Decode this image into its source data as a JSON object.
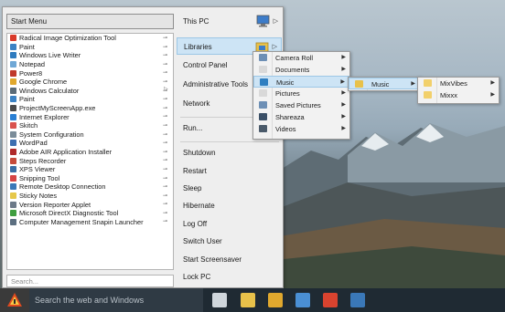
{
  "start_menu": {
    "title": "Start Menu",
    "search_placeholder": "Search...",
    "programs": [
      {
        "label": "Radical Image Optimization Tool",
        "icon": "rito-icon",
        "color": "#d93a2a"
      },
      {
        "label": "Paint",
        "icon": "paint-icon",
        "color": "#3b82c4"
      },
      {
        "label": "Windows Live Writer",
        "icon": "live-writer-icon",
        "color": "#2e7bbf"
      },
      {
        "label": "Notepad",
        "icon": "notepad-icon",
        "color": "#6fa8d6"
      },
      {
        "label": "Power8",
        "icon": "power8-icon",
        "color": "#c0392b"
      },
      {
        "label": "Google Chrome",
        "icon": "chrome-icon",
        "color": "#e0a82e"
      },
      {
        "label": "Windows Calculator",
        "icon": "calculator-icon",
        "color": "#5a6b78"
      },
      {
        "label": "Paint",
        "icon": "paint-icon",
        "color": "#3b82c4"
      },
      {
        "label": "ProjectMyScreenApp.exe",
        "icon": "project-screen-icon",
        "color": "#4a4a4a"
      },
      {
        "label": "Internet Explorer",
        "icon": "internet-explorer-icon",
        "color": "#2a7fd4"
      },
      {
        "label": "Skitch",
        "icon": "skitch-icon",
        "color": "#d9534f"
      },
      {
        "label": "System Configuration",
        "icon": "system-config-icon",
        "color": "#7a8c99"
      },
      {
        "label": "WordPad",
        "icon": "wordpad-icon",
        "color": "#3d6fb0"
      },
      {
        "label": "Adobe AIR Application Installer",
        "icon": "adobe-air-icon",
        "color": "#b02a2a"
      },
      {
        "label": "Steps Recorder",
        "icon": "steps-recorder-icon",
        "color": "#c64b3b"
      },
      {
        "label": "XPS Viewer",
        "icon": "xps-viewer-icon",
        "color": "#3a6ea5"
      },
      {
        "label": "Snipping Tool",
        "icon": "snipping-tool-icon",
        "color": "#d64545"
      },
      {
        "label": "Remote Desktop Connection",
        "icon": "remote-desktop-icon",
        "color": "#3a78b8"
      },
      {
        "label": "Sticky Notes",
        "icon": "sticky-notes-icon",
        "color": "#e6c84a"
      },
      {
        "label": "Version Reporter Applet",
        "icon": "version-reporter-icon",
        "color": "#6c7a89"
      },
      {
        "label": "Microsoft DirectX Diagnostic Tool",
        "icon": "directx-icon",
        "color": "#3f9e3f"
      },
      {
        "label": "Computer Management Snapin Launcher",
        "icon": "computer-management-icon",
        "color": "#5c6f80"
      }
    ],
    "right_items": [
      {
        "label": "This PC",
        "arrow": true
      },
      {
        "label": "Libraries",
        "arrow": true,
        "highlighted": true
      },
      {
        "label": "Control Panel",
        "arrow": false
      },
      {
        "label": "Administrative Tools",
        "arrow": true
      },
      {
        "label": "Network",
        "arrow": false
      },
      {
        "label": "Run...",
        "arrow": false
      },
      {
        "label": "Shutdown",
        "arrow": false
      },
      {
        "label": "Restart",
        "arrow": false
      },
      {
        "label": "Sleep",
        "arrow": false
      },
      {
        "label": "Hibernate",
        "arrow": false
      },
      {
        "label": "Log Off",
        "arrow": false
      },
      {
        "label": "Switch User",
        "arrow": false
      },
      {
        "label": "Start Screensaver",
        "arrow": false
      },
      {
        "label": "Lock PC",
        "arrow": false
      }
    ]
  },
  "libraries_menu": [
    {
      "label": "Camera Roll",
      "icon": "camera-roll-folder-icon",
      "color": "#6d8fb5"
    },
    {
      "label": "Documents",
      "icon": "documents-folder-icon",
      "color": "#d9d9d9"
    },
    {
      "label": "Music",
      "icon": "music-folder-icon",
      "color": "#2f7fc1",
      "highlighted": true
    },
    {
      "label": "Pictures",
      "icon": "pictures-folder-icon",
      "color": "#d9d9d9"
    },
    {
      "label": "Saved Pictures",
      "icon": "saved-pictures-folder-icon",
      "color": "#6d8fb5"
    },
    {
      "label": "Shareaza",
      "icon": "shareaza-folder-icon",
      "color": "#3a4f66"
    },
    {
      "label": "Videos",
      "icon": "videos-folder-icon",
      "color": "#4a5a6a"
    }
  ],
  "music_menu": [
    {
      "label": "Music",
      "icon": "music-folder-icon",
      "color": "#e8c14a",
      "highlighted": true
    }
  ],
  "music_sub_menu": [
    {
      "label": "MixVibes",
      "icon": "folder-icon",
      "color": "#f2d06b"
    },
    {
      "label": "Mixxx",
      "icon": "folder-icon",
      "color": "#f2d06b"
    }
  ],
  "taskbar": {
    "search_text": "Search the web and Windows",
    "icons": [
      {
        "name": "task-view-icon",
        "color": "#cfd6dc"
      },
      {
        "name": "file-explorer-icon",
        "color": "#e8c14a"
      },
      {
        "name": "chrome-icon",
        "color": "#e0a82e"
      },
      {
        "name": "app-icon",
        "color": "#4a8fd4"
      },
      {
        "name": "app-red-icon",
        "color": "#d9432f"
      },
      {
        "name": "computer-icon",
        "color": "#3a78b8"
      }
    ]
  }
}
